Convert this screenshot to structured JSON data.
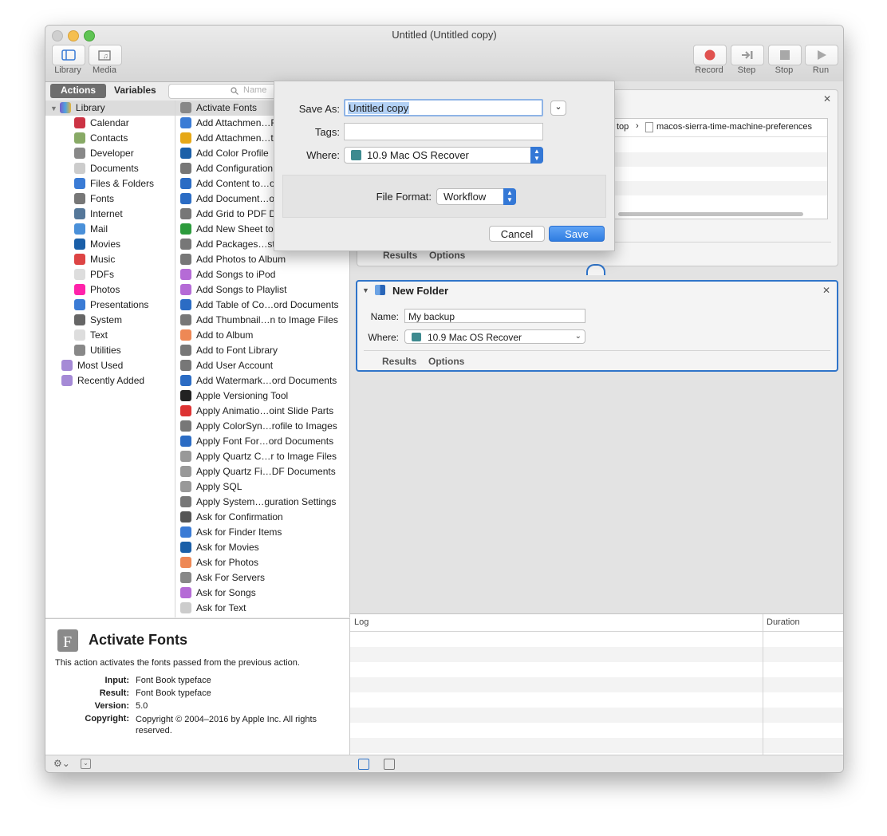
{
  "window": {
    "title": "Untitled (Untitled copy)"
  },
  "toolbar": {
    "left": [
      {
        "label": "Library",
        "icon": "library-icon"
      },
      {
        "label": "Media",
        "icon": "media-icon"
      }
    ],
    "right": [
      {
        "label": "Record",
        "icon": "record-icon"
      },
      {
        "label": "Step",
        "icon": "step-icon"
      },
      {
        "label": "Stop",
        "icon": "stop-icon"
      },
      {
        "label": "Run",
        "icon": "run-icon"
      }
    ]
  },
  "tabs": {
    "actions": "Actions",
    "variables": "Variables"
  },
  "search": {
    "placeholder": "Name"
  },
  "library": {
    "root": "Library",
    "items": [
      "Calendar",
      "Contacts",
      "Developer",
      "Documents",
      "Files & Folders",
      "Fonts",
      "Internet",
      "Mail",
      "Movies",
      "Music",
      "PDFs",
      "Photos",
      "Presentations",
      "System",
      "Text",
      "Utilities"
    ],
    "smart": [
      "Most Used",
      "Recently Added"
    ]
  },
  "actions": {
    "items": [
      "Activate Fonts",
      "Add Attachmen…Fr",
      "Add Attachmen…tio",
      "Add Color Profile",
      "Add Configuration",
      "Add Content to…or",
      "Add Document…ord",
      "Add Grid to PDF Do",
      "Add New Sheet to",
      "Add Packages…st-",
      "Add Photos to Album",
      "Add Songs to iPod",
      "Add Songs to Playlist",
      "Add Table of Co…ord Documents",
      "Add Thumbnail…n to Image Files",
      "Add to Album",
      "Add to Font Library",
      "Add User Account",
      "Add Watermark…ord Documents",
      "Apple Versioning Tool",
      "Apply Animatio…oint Slide Parts",
      "Apply ColorSyn…rofile to Images",
      "Apply Font For…ord Documents",
      "Apply Quartz C…r to Image Files",
      "Apply Quartz Fi…DF Documents",
      "Apply SQL",
      "Apply System…guration Settings",
      "Ask for Confirmation",
      "Ask for Finder Items",
      "Ask for Movies",
      "Ask for Photos",
      "Ask For Servers",
      "Ask for Songs",
      "Ask for Text"
    ]
  },
  "description": {
    "title": "Activate Fonts",
    "summary": "This action activates the fonts passed from the previous action.",
    "input_label": "Input:",
    "input": "Font Book typeface",
    "result_label": "Result:",
    "result": "Font Book typeface",
    "version_label": "Version:",
    "version": "5.0",
    "copyright_label": "Copyright:",
    "copyright": "Copyright © 2004–2016 by Apple Inc. All rights reserved."
  },
  "workflow": {
    "path_fragment": "top",
    "path_item": "macos-sierra-time-machine-preferences",
    "card1_tabs": [
      "Results",
      "Options"
    ],
    "new_folder": {
      "title": "New Folder",
      "name_label": "Name:",
      "name_value": "My backup",
      "where_label": "Where:",
      "where_value": "10.9 Mac OS Recover",
      "tabs": [
        "Results",
        "Options"
      ]
    }
  },
  "log": {
    "columns": [
      "Log",
      "Duration"
    ]
  },
  "save_sheet": {
    "save_as_label": "Save As:",
    "save_as_value": "Untitled copy",
    "tags_label": "Tags:",
    "where_label": "Where:",
    "where_value": "10.9 Mac OS Recover",
    "format_label": "File Format:",
    "format_value": "Workflow",
    "cancel": "Cancel",
    "save": "Save"
  },
  "colors": {
    "accent": "#2f74c9",
    "selection": "#b3d1f5",
    "record_red": "#e0524f"
  }
}
